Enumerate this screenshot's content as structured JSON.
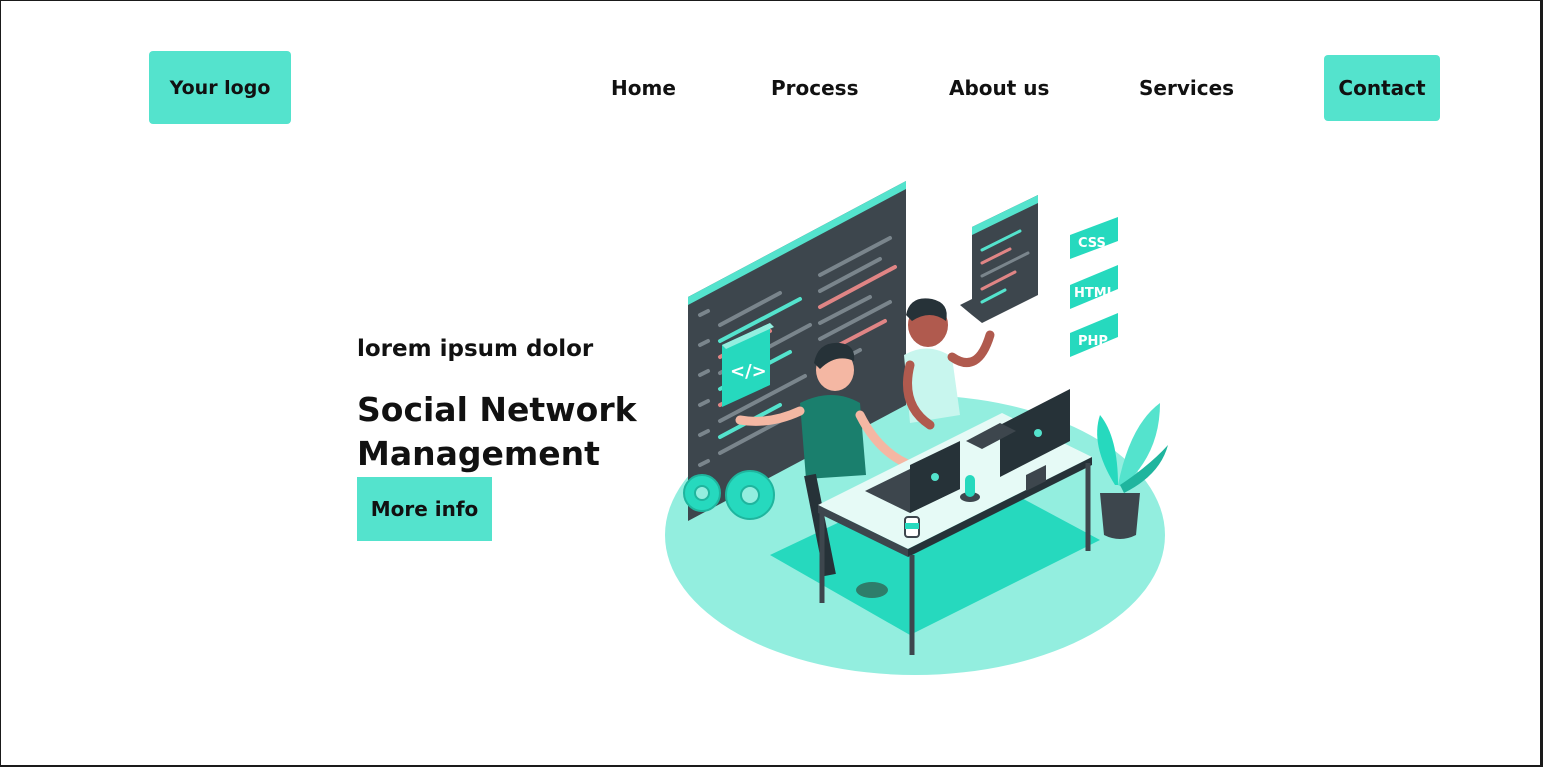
{
  "header": {
    "logo_label": "Your logo",
    "nav": {
      "home": "Home",
      "process": "Process",
      "about": "About us",
      "services": "Services"
    },
    "contact_label": "Contact"
  },
  "hero": {
    "eyebrow": "lorem ipsum dolor",
    "title_line1": "Social Network",
    "title_line2": "Management",
    "cta_label": "More info"
  },
  "illustration": {
    "code_glyph": "</>",
    "tags": [
      "CSS",
      "HTML",
      "PHP"
    ]
  },
  "colors": {
    "accent": "#54e3cd",
    "accent_light": "#93eedf",
    "accent_dark": "#26d9be",
    "panel_dark": "#3d464d",
    "text": "#111111"
  }
}
